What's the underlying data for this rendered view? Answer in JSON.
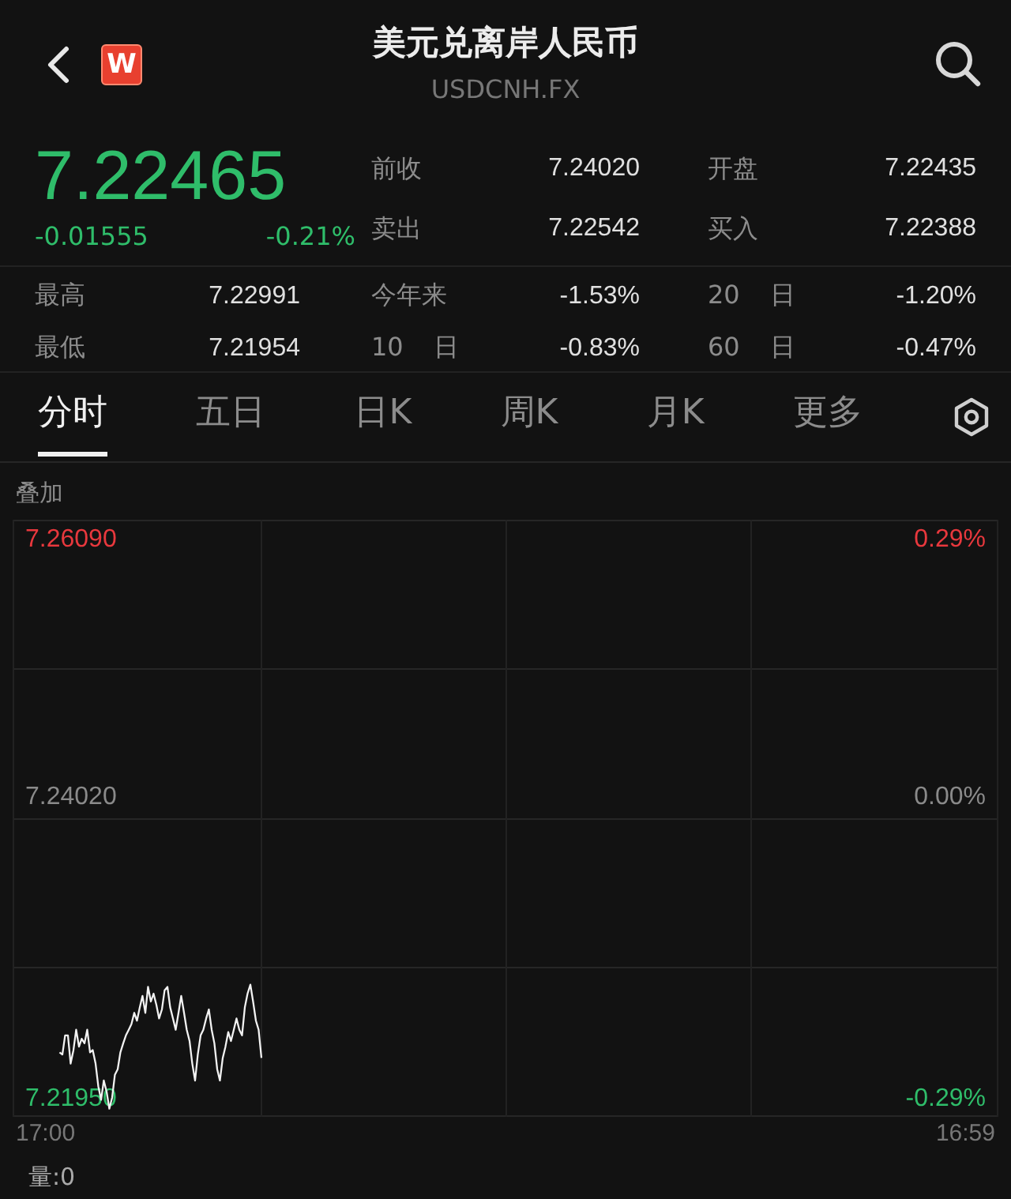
{
  "header": {
    "title": "美元兑离岸人民币",
    "symbol": "USDCNH.FX",
    "logo": "W"
  },
  "quote": {
    "price": "7.22465",
    "change": "-0.01555",
    "change_pct": "-0.21%",
    "color": "#2fbd6a"
  },
  "top_stats": [
    {
      "label": "前收",
      "value": "7.24020"
    },
    {
      "label": "开盘",
      "value": "7.22435"
    },
    {
      "label": "卖出",
      "value": "7.22542"
    },
    {
      "label": "买入",
      "value": "7.22388"
    }
  ],
  "range_stats": [
    {
      "label": "最高",
      "value": "7.22991"
    },
    {
      "label": "今年来",
      "value": "-1.53%"
    },
    {
      "label": "20 日",
      "value": "-1.20%"
    },
    {
      "label": "最低",
      "value": "7.21954"
    },
    {
      "label": "10 日",
      "value": "-0.83%"
    },
    {
      "label": "60 日",
      "value": "-0.47%"
    }
  ],
  "tabs": [
    {
      "label": "分时",
      "selected": true
    },
    {
      "label": "五日",
      "selected": false
    },
    {
      "label": "日K",
      "selected": false
    },
    {
      "label": "周K",
      "selected": false
    },
    {
      "label": "月K",
      "selected": false
    },
    {
      "label": "更多",
      "selected": false
    }
  ],
  "overlay_label": "叠加",
  "chart": {
    "levels": [
      {
        "price": "7.26090",
        "pct": "0.29%",
        "color": "#e8383d"
      },
      {
        "price": "7.24020",
        "pct": "0.00%",
        "color": "#8a8a8a"
      },
      {
        "price": "7.21950",
        "pct": "-0.29%",
        "color": "#2fbd6a"
      }
    ],
    "start_time": "17:00",
    "end_time": "16:59"
  },
  "volume": "量:0"
}
